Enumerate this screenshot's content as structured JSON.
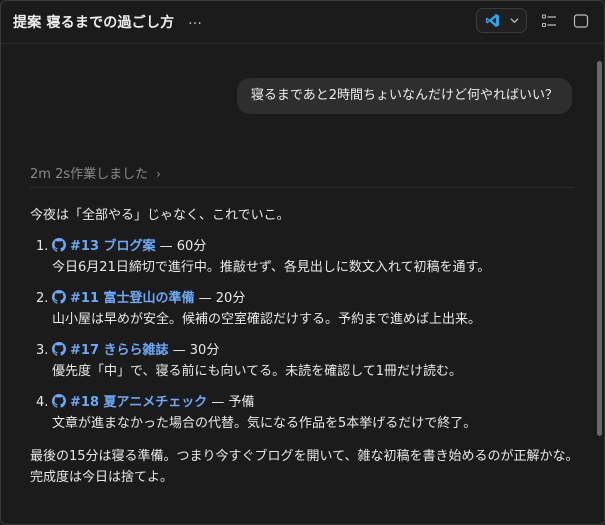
{
  "header": {
    "title": "提案 寝るまでの過ごし方",
    "more_label": "…",
    "ide": "vscode-icon"
  },
  "conversation": {
    "user_message": "寝るまであと2時間ちょいなんだけど何やればいい？",
    "worked_label": "2m 2s作業しました",
    "intro": "今夜は「全部やる」じゃなく、これでいこ。",
    "tasks": [
      {
        "number": "1.",
        "link": "#13 ブログ案",
        "estimate": "— 60分",
        "description": "今日6月21日締切で進行中。推敲せず、各見出しに数文入れて初稿を通す。"
      },
      {
        "number": "2.",
        "link": "#11 富士登山の準備",
        "estimate": "— 20分",
        "description": "山小屋は早めが安全。候補の空室確認だけする。予約まで進めば上出来。"
      },
      {
        "number": "3.",
        "link": "#17 きらら雑誌",
        "estimate": "— 30分",
        "description": "優先度「中」で、寝る前にも向いてる。未読を確認して1冊だけ読む。"
      },
      {
        "number": "4.",
        "link": "#18 夏アニメチェック",
        "estimate": "— 予備",
        "description": "文章が進まなかった場合の代替。気になる作品を5本挙げるだけで終了。"
      }
    ],
    "closing": "最後の15分は寝る準備。つまり今すぐブログを開いて、雑な初稿を書き始めるのが正解かな。完成度は今日は捨てよ。"
  },
  "colors": {
    "background": "#1b1b1b",
    "bubble": "#2e2e2e",
    "link": "#6ea8f7",
    "muted": "#8a8a8a",
    "vscode": "#23a8f2"
  }
}
